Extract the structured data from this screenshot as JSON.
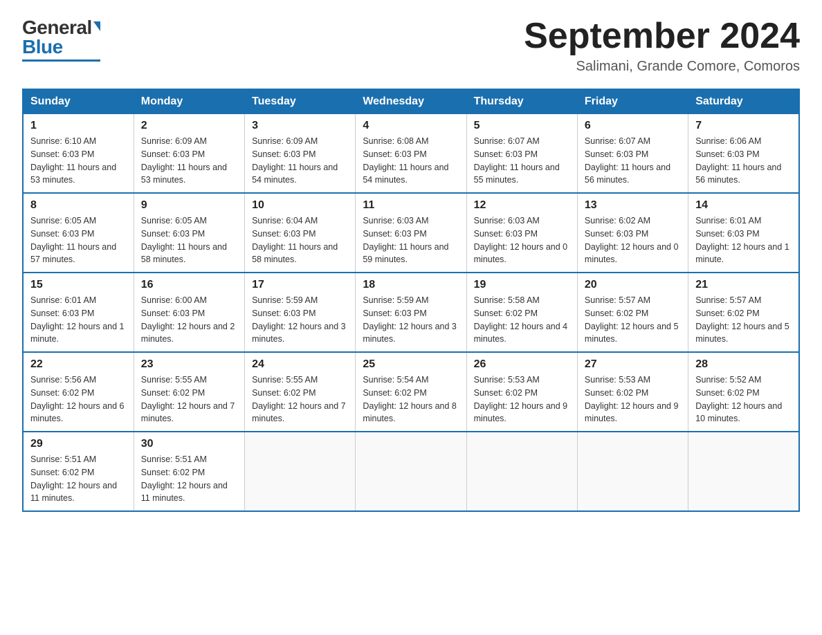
{
  "header": {
    "logo_general": "General",
    "logo_blue": "Blue",
    "month_title": "September 2024",
    "location": "Salimani, Grande Comore, Comoros"
  },
  "weekdays": [
    "Sunday",
    "Monday",
    "Tuesday",
    "Wednesday",
    "Thursday",
    "Friday",
    "Saturday"
  ],
  "weeks": [
    [
      {
        "day": "1",
        "sunrise": "6:10 AM",
        "sunset": "6:03 PM",
        "daylight": "11 hours and 53 minutes."
      },
      {
        "day": "2",
        "sunrise": "6:09 AM",
        "sunset": "6:03 PM",
        "daylight": "11 hours and 53 minutes."
      },
      {
        "day": "3",
        "sunrise": "6:09 AM",
        "sunset": "6:03 PM",
        "daylight": "11 hours and 54 minutes."
      },
      {
        "day": "4",
        "sunrise": "6:08 AM",
        "sunset": "6:03 PM",
        "daylight": "11 hours and 54 minutes."
      },
      {
        "day": "5",
        "sunrise": "6:07 AM",
        "sunset": "6:03 PM",
        "daylight": "11 hours and 55 minutes."
      },
      {
        "day": "6",
        "sunrise": "6:07 AM",
        "sunset": "6:03 PM",
        "daylight": "11 hours and 56 minutes."
      },
      {
        "day": "7",
        "sunrise": "6:06 AM",
        "sunset": "6:03 PM",
        "daylight": "11 hours and 56 minutes."
      }
    ],
    [
      {
        "day": "8",
        "sunrise": "6:05 AM",
        "sunset": "6:03 PM",
        "daylight": "11 hours and 57 minutes."
      },
      {
        "day": "9",
        "sunrise": "6:05 AM",
        "sunset": "6:03 PM",
        "daylight": "11 hours and 58 minutes."
      },
      {
        "day": "10",
        "sunrise": "6:04 AM",
        "sunset": "6:03 PM",
        "daylight": "11 hours and 58 minutes."
      },
      {
        "day": "11",
        "sunrise": "6:03 AM",
        "sunset": "6:03 PM",
        "daylight": "11 hours and 59 minutes."
      },
      {
        "day": "12",
        "sunrise": "6:03 AM",
        "sunset": "6:03 PM",
        "daylight": "12 hours and 0 minutes."
      },
      {
        "day": "13",
        "sunrise": "6:02 AM",
        "sunset": "6:03 PM",
        "daylight": "12 hours and 0 minutes."
      },
      {
        "day": "14",
        "sunrise": "6:01 AM",
        "sunset": "6:03 PM",
        "daylight": "12 hours and 1 minute."
      }
    ],
    [
      {
        "day": "15",
        "sunrise": "6:01 AM",
        "sunset": "6:03 PM",
        "daylight": "12 hours and 1 minute."
      },
      {
        "day": "16",
        "sunrise": "6:00 AM",
        "sunset": "6:03 PM",
        "daylight": "12 hours and 2 minutes."
      },
      {
        "day": "17",
        "sunrise": "5:59 AM",
        "sunset": "6:03 PM",
        "daylight": "12 hours and 3 minutes."
      },
      {
        "day": "18",
        "sunrise": "5:59 AM",
        "sunset": "6:03 PM",
        "daylight": "12 hours and 3 minutes."
      },
      {
        "day": "19",
        "sunrise": "5:58 AM",
        "sunset": "6:02 PM",
        "daylight": "12 hours and 4 minutes."
      },
      {
        "day": "20",
        "sunrise": "5:57 AM",
        "sunset": "6:02 PM",
        "daylight": "12 hours and 5 minutes."
      },
      {
        "day": "21",
        "sunrise": "5:57 AM",
        "sunset": "6:02 PM",
        "daylight": "12 hours and 5 minutes."
      }
    ],
    [
      {
        "day": "22",
        "sunrise": "5:56 AM",
        "sunset": "6:02 PM",
        "daylight": "12 hours and 6 minutes."
      },
      {
        "day": "23",
        "sunrise": "5:55 AM",
        "sunset": "6:02 PM",
        "daylight": "12 hours and 7 minutes."
      },
      {
        "day": "24",
        "sunrise": "5:55 AM",
        "sunset": "6:02 PM",
        "daylight": "12 hours and 7 minutes."
      },
      {
        "day": "25",
        "sunrise": "5:54 AM",
        "sunset": "6:02 PM",
        "daylight": "12 hours and 8 minutes."
      },
      {
        "day": "26",
        "sunrise": "5:53 AM",
        "sunset": "6:02 PM",
        "daylight": "12 hours and 9 minutes."
      },
      {
        "day": "27",
        "sunrise": "5:53 AM",
        "sunset": "6:02 PM",
        "daylight": "12 hours and 9 minutes."
      },
      {
        "day": "28",
        "sunrise": "5:52 AM",
        "sunset": "6:02 PM",
        "daylight": "12 hours and 10 minutes."
      }
    ],
    [
      {
        "day": "29",
        "sunrise": "5:51 AM",
        "sunset": "6:02 PM",
        "daylight": "12 hours and 11 minutes."
      },
      {
        "day": "30",
        "sunrise": "5:51 AM",
        "sunset": "6:02 PM",
        "daylight": "12 hours and 11 minutes."
      },
      null,
      null,
      null,
      null,
      null
    ]
  ]
}
